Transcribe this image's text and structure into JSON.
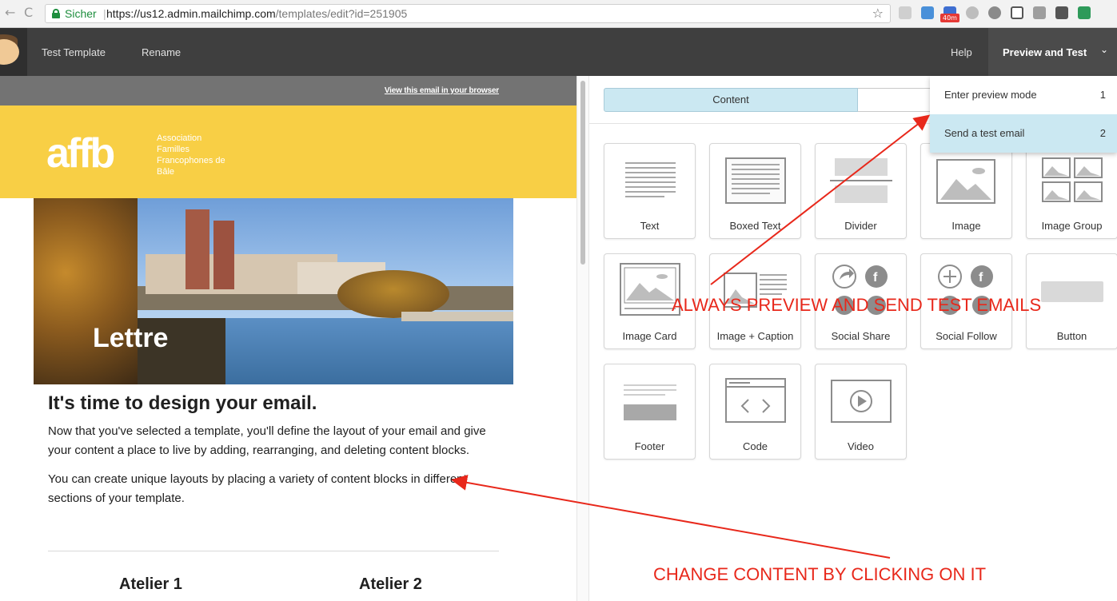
{
  "browser": {
    "back": "←",
    "reload": "C",
    "secure_label": "Sicher",
    "separator": "|",
    "url_host": "https://us12.admin.mailchimp.com",
    "url_path": "/templates/edit?id=251905",
    "bookmark": "☆",
    "ext_badge": "40m"
  },
  "header": {
    "nav": [
      "Test Template",
      "Rename"
    ],
    "help": "Help",
    "preview_button": "Preview and Test",
    "chevron": "⌄"
  },
  "dropdown": {
    "items": [
      {
        "label": "Enter preview mode",
        "shortcut": "1"
      },
      {
        "label": "Send a test email",
        "shortcut": "2"
      }
    ]
  },
  "email": {
    "view_link": "View this email in your browser",
    "brand_logo": "affb",
    "brand_sub": [
      "Association",
      "Familles",
      "Francophones de",
      "Bâle"
    ],
    "hero_text": "Lettre",
    "heading": "It's time to design your email.",
    "para1": "Now that you've selected a template, you'll define the layout of your email and give your content a place to live by adding, rearranging, and deleting content blocks.",
    "para2": "You can create unique layouts by placing a variety of content blocks in different sections of your template.",
    "ateliers": [
      "Atelier 1",
      "Atelier 2"
    ]
  },
  "editor": {
    "tabs": [
      "Content"
    ],
    "blocks": [
      "Text",
      "Boxed Text",
      "Divider",
      "Image",
      "Image Group",
      "Image Card",
      "Image + Caption",
      "Social Share",
      "Social Follow",
      "Button",
      "Footer",
      "Code",
      "Video"
    ]
  },
  "annotations": {
    "preview": "ALWAYS PREVIEW AND SEND TEST EMAILS",
    "content": "CHANGE CONTENT BY CLICKING ON IT",
    "color": "#e8281b"
  },
  "colors": {
    "header_bg": "#3f3f3f",
    "brand_yellow": "#f8cf45",
    "active_tab": "#cbe8f2"
  }
}
